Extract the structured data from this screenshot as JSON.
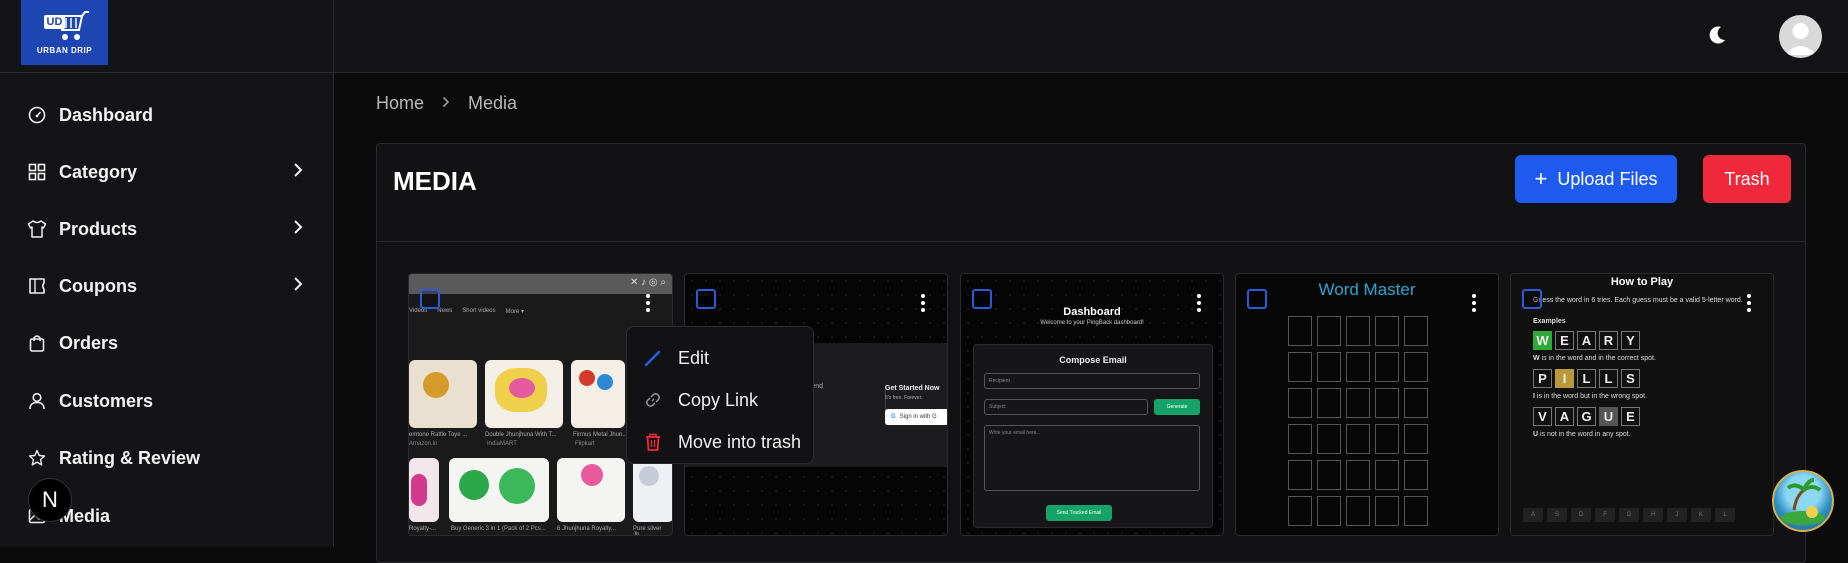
{
  "brand": {
    "badge": "UD",
    "name": "URBAN DRIP",
    "color": "#1d46b3"
  },
  "sidebar": {
    "items": [
      {
        "label": "Dashboard",
        "icon": "gauge-icon",
        "has_children": false
      },
      {
        "label": "Category",
        "icon": "grid-icon",
        "has_children": true
      },
      {
        "label": "Products",
        "icon": "shirt-icon",
        "has_children": true
      },
      {
        "label": "Coupons",
        "icon": "ticket-icon",
        "has_children": true
      },
      {
        "label": "Orders",
        "icon": "bag-icon",
        "has_children": false
      },
      {
        "label": "Customers",
        "icon": "user-icon",
        "has_children": false
      },
      {
        "label": "Rating & Review",
        "icon": "star-icon",
        "has_children": false
      },
      {
        "label": "Media",
        "icon": "image-icon",
        "has_children": false
      }
    ],
    "dev_badge": "N"
  },
  "topbar": {
    "theme_icon": "moon-icon",
    "avatar_icon": "avatar-icon"
  },
  "breadcrumb": {
    "home": "Home",
    "current": "Media"
  },
  "panel": {
    "title": "MEDIA",
    "upload_label": "Upload Files",
    "trash_label": "Trash"
  },
  "context_menu": {
    "items": [
      {
        "label": "Edit",
        "icon": "pencil-icon"
      },
      {
        "label": "Copy Link",
        "icon": "link-icon"
      },
      {
        "label": "Move into trash",
        "icon": "trash-icon"
      }
    ]
  },
  "cards": {
    "shopping": {
      "tabs": [
        "Videos",
        "News",
        "Short videos",
        "More ▾"
      ],
      "captions_row1": [
        "emtone Rattle Toye ...",
        "Double Jhunjhuna With T...",
        "Firmus Metal Jhun..."
      ],
      "sources_row1": [
        "Amazon.in",
        "IndiaMART",
        "Flipkart"
      ],
      "captions_row2": [
        "Royalty-...",
        "Buy Generic 3 in 1 (Pack of 2 Pcs...",
        "6 Jhunjhuna Royalty...",
        "Pure silver Jh..."
      ]
    },
    "signin": {
      "fragment": "ad. Send",
      "title": "Get Started Now",
      "sub": "It's free. Forever.",
      "button": "Sign in with G"
    },
    "dashboard": {
      "title": "Dashboard",
      "subtitle": "Welcome to your PingBack dashboard!",
      "compose": "Compose Email",
      "recipient": "Recipient",
      "subject": "Subject",
      "generate": "Generate",
      "body": "Write your email here...",
      "send": "Send Tracked Email"
    },
    "wordmaster": {
      "title": "Word Master"
    },
    "howto": {
      "title": "How to Play",
      "intro": "Guess the word in 6 tries. Each guess must be a valid 5-letter word.",
      "examples": "Examples",
      "word1": [
        "W",
        "E",
        "A",
        "R",
        "Y"
      ],
      "text1_letter": "W",
      "text1": " is in the word and in the correct spot.",
      "word2": [
        "P",
        "I",
        "L",
        "L",
        "S"
      ],
      "text2_letter": "I",
      "text2": " is in the word but in the wrong spot.",
      "word3": [
        "V",
        "A",
        "G",
        "U",
        "E"
      ],
      "text3_letter": "U",
      "text3": " is not in the word in any spot.",
      "keys": [
        "A",
        "S",
        "D",
        "F",
        "G",
        "H",
        "J",
        "K",
        "L"
      ]
    }
  }
}
